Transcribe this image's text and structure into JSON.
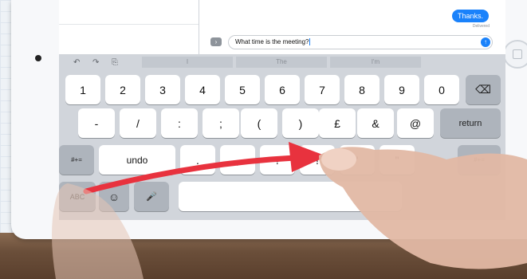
{
  "messages": {
    "sent_bubble": "Thanks.",
    "status": "Delivered",
    "compose_text": "What time is the meeting?",
    "camera_glyph": "›",
    "send_glyph": "↑"
  },
  "toolbar": {
    "undo_glyph": "↶",
    "redo_glyph": "↷",
    "paste_glyph": "⎘",
    "predictions": [
      "I",
      "The",
      "I'm"
    ]
  },
  "keyboard": {
    "row1": [
      "1",
      "2",
      "3",
      "4",
      "5",
      "6",
      "7",
      "8",
      "9",
      "0"
    ],
    "backspace_glyph": "⌫",
    "row2": [
      "-",
      "/",
      ":",
      ";",
      "(",
      ")",
      "£",
      "&",
      "@"
    ],
    "return_label": "return",
    "row3_left": "#+=",
    "row3_undo": "undo",
    "row3_keys": [
      ".",
      ",",
      "?",
      "!",
      "'",
      "\""
    ],
    "row3_right": "#+=",
    "abc_label": "ABC",
    "emoji_glyph": "☺",
    "mic_glyph": "🎤"
  },
  "colors": {
    "accent": "#1a82fb",
    "arrow": "#e8323e"
  }
}
